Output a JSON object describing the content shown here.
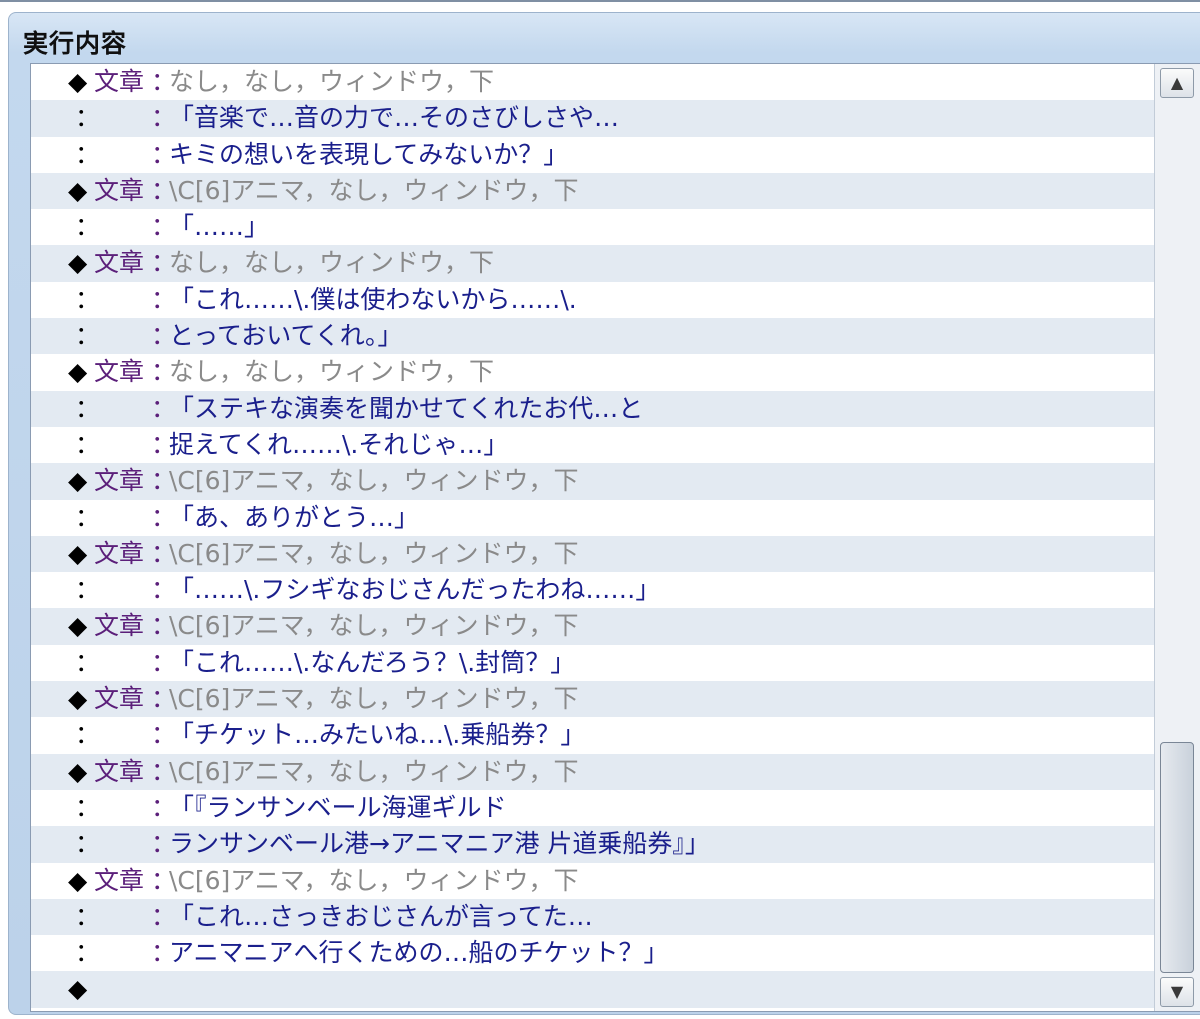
{
  "panel": {
    "title": "実行内容"
  },
  "scrollbar": {
    "up_arrow": "▲",
    "down_arrow": "▼",
    "thumb_start_fraction": 0.735,
    "thumb_end_fraction": 1.0
  },
  "rows": [
    {
      "kind": "command",
      "marker": "◆",
      "command": "文章",
      "separator": "：",
      "text": "なし，なし，ウィンドウ，下"
    },
    {
      "kind": "continuation",
      "marker": "：",
      "separator": "：",
      "text": "「音楽で…音の力で…そのさびしさや…"
    },
    {
      "kind": "continuation",
      "marker": "：",
      "separator": "：",
      "text": "キミの想いを表現してみないか？」"
    },
    {
      "kind": "command",
      "marker": "◆",
      "command": "文章",
      "separator": "：",
      "text": "\\C[6]アニマ，なし，ウィンドウ，下"
    },
    {
      "kind": "continuation",
      "marker": "：",
      "separator": "：",
      "text": "「……」"
    },
    {
      "kind": "command",
      "marker": "◆",
      "command": "文章",
      "separator": "：",
      "text": "なし，なし，ウィンドウ，下"
    },
    {
      "kind": "continuation",
      "marker": "：",
      "separator": "：",
      "text": "「これ……\\.僕は使わないから……\\."
    },
    {
      "kind": "continuation",
      "marker": "：",
      "separator": "：",
      "text": "とっておいてくれ。」"
    },
    {
      "kind": "command",
      "marker": "◆",
      "command": "文章",
      "separator": "：",
      "text": "なし，なし，ウィンドウ，下"
    },
    {
      "kind": "continuation",
      "marker": "：",
      "separator": "：",
      "text": "「ステキな演奏を聞かせてくれたお代…と"
    },
    {
      "kind": "continuation",
      "marker": "：",
      "separator": "：",
      "text": "捉えてくれ……\\.それじゃ…」"
    },
    {
      "kind": "command",
      "marker": "◆",
      "command": "文章",
      "separator": "：",
      "text": "\\C[6]アニマ，なし，ウィンドウ，下"
    },
    {
      "kind": "continuation",
      "marker": "：",
      "separator": "：",
      "text": "「あ、ありがとう…」"
    },
    {
      "kind": "command",
      "marker": "◆",
      "command": "文章",
      "separator": "：",
      "text": "\\C[6]アニマ，なし，ウィンドウ，下"
    },
    {
      "kind": "continuation",
      "marker": "：",
      "separator": "：",
      "text": "「……\\.フシギなおじさんだったわね……」"
    },
    {
      "kind": "command",
      "marker": "◆",
      "command": "文章",
      "separator": "：",
      "text": "\\C[6]アニマ，なし，ウィンドウ，下"
    },
    {
      "kind": "continuation",
      "marker": "：",
      "separator": "：",
      "text": "「これ……\\.なんだろう？\\.封筒？」"
    },
    {
      "kind": "command",
      "marker": "◆",
      "command": "文章",
      "separator": "：",
      "text": "\\C[6]アニマ，なし，ウィンドウ，下"
    },
    {
      "kind": "continuation",
      "marker": "：",
      "separator": "：",
      "text": "「チケット…みたいね…\\.乗船券？」"
    },
    {
      "kind": "command",
      "marker": "◆",
      "command": "文章",
      "separator": "：",
      "text": "\\C[6]アニマ，なし，ウィンドウ，下"
    },
    {
      "kind": "continuation",
      "marker": "：",
      "separator": "：",
      "text": "「『ランサンベール海運ギルド"
    },
    {
      "kind": "continuation",
      "marker": "：",
      "separator": "：",
      "text": "ランサンベール港→アニマニア港 片道乗船券』」"
    },
    {
      "kind": "command",
      "marker": "◆",
      "command": "文章",
      "separator": "：",
      "text": "\\C[6]アニマ，なし，ウィンドウ，下"
    },
    {
      "kind": "continuation",
      "marker": "：",
      "separator": "：",
      "text": "「これ…さっきおじさんが言ってた…"
    },
    {
      "kind": "continuation",
      "marker": "：",
      "separator": "：",
      "text": "アニマニアへ行くための…船のチケット？」"
    },
    {
      "kind": "empty",
      "marker": "◆",
      "command": "",
      "separator": "",
      "text": ""
    }
  ]
}
